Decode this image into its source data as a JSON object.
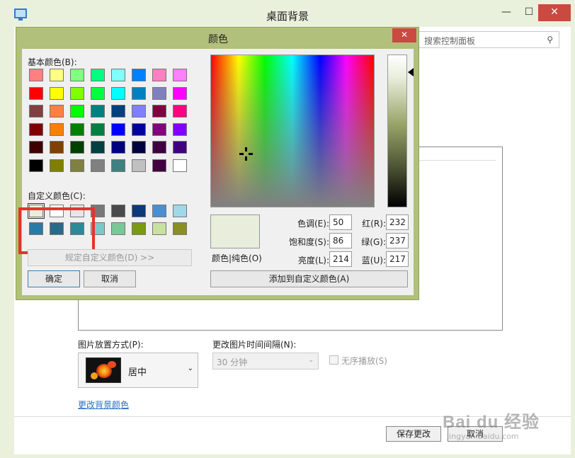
{
  "outer": {
    "title": "桌面背景",
    "min_glyph": "—",
    "max_glyph": "☐",
    "close_glyph": "✕",
    "search_placeholder": "搜索控制面板",
    "search_glyph": "⚲",
    "position_label": "图片放置方式(P):",
    "position_value": "居中",
    "dropdown_glyph": "⌄",
    "interval_label": "更改图片时间间隔(N):",
    "interval_value": "30 分钟",
    "shuffle_label": "无序播放(S)",
    "change_color_link": "更改背景颜色",
    "save_label": "保存更改",
    "cancel_label": "取消"
  },
  "watermark": {
    "text": "Bai du 经验",
    "sub": "jingyan.baidu.com"
  },
  "dialog": {
    "title": "颜色",
    "close_glyph": "✕",
    "basic_label": "基本颜色(B):",
    "custom_label": "自定义颜色(C):",
    "define_label": "规定自定义颜色(D) >>",
    "ok_label": "确定",
    "cancel_label": "取消",
    "preview_caption": "颜色|纯色(O)",
    "add_label": "添加到自定义颜色(A)",
    "selected_color": "#e8eddc",
    "fields": {
      "hue_label": "色调(E):",
      "hue": "50",
      "sat_label": "饱和度(S):",
      "sat": "86",
      "lum_label": "亮度(L):",
      "lum": "214",
      "red_label": "红(R):",
      "red": "232",
      "green_label": "绿(G):",
      "green": "237",
      "blue_label": "蓝(U):",
      "blue": "217"
    },
    "basic_colors": [
      "#ff8080",
      "#ffff80",
      "#80ff80",
      "#00ff80",
      "#80ffff",
      "#0080ff",
      "#ff80c0",
      "#ff80ff",
      "#ff0000",
      "#ffff00",
      "#80ff00",
      "#00ff40",
      "#00ffff",
      "#0080c0",
      "#8080c0",
      "#ff00ff",
      "#804040",
      "#ff8040",
      "#00ff00",
      "#008080",
      "#004080",
      "#8080ff",
      "#800040",
      "#ff0080",
      "#800000",
      "#ff8000",
      "#008000",
      "#008040",
      "#0000ff",
      "#0000a0",
      "#800080",
      "#8000ff",
      "#400000",
      "#804000",
      "#004000",
      "#004040",
      "#000080",
      "#000040",
      "#400040",
      "#400080",
      "#000000",
      "#808000",
      "#808040",
      "#808080",
      "#408080",
      "#c0c0c0",
      "#400040",
      "#ffffff"
    ],
    "custom_colors": [
      "#e8eddc",
      "#ffffff",
      "#e6e6e6",
      "#787878",
      "#4a4a4a",
      "#0a3a78",
      "#4a90d0",
      "#a0d8e8",
      "#2a7aa8",
      "#2a6a88",
      "#2a8a98",
      "#7ac8c8",
      "#7ac898",
      "#7a9a10",
      "#c8e0a0",
      "#8a9020"
    ]
  }
}
